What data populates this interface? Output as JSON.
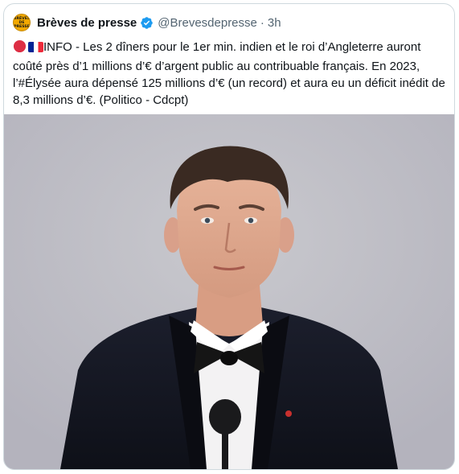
{
  "tweet": {
    "author": {
      "display_name": "Brèves de presse",
      "handle": "@Brevesdepresse",
      "verified_icon": "verified-badge-icon",
      "avatar_text": "BRÈVES DE PRESSE"
    },
    "separator": "·",
    "time": "3h",
    "text_emojis": [
      "red-circle-emoji",
      "french-flag-emoji"
    ],
    "text": "INFO - Les 2 dîners pour le 1er min. indien et le roi d’Angleterre auront coûté près d’1 millions d’€ d’argent public au contribuable français. En 2023, l’#Élysée aura dépensé 125 millions d’€ (un record) et aura eu un déficit inédit de 8,3 millions d’€. (Politico - Cdcpt)",
    "media": {
      "type": "photo",
      "subject": "man in tuxedo with bow tie at microphone"
    }
  },
  "colors": {
    "text": "#0f1419",
    "secondary": "#536471",
    "verified": "#1d9bf0",
    "border": "#cfd9de"
  }
}
